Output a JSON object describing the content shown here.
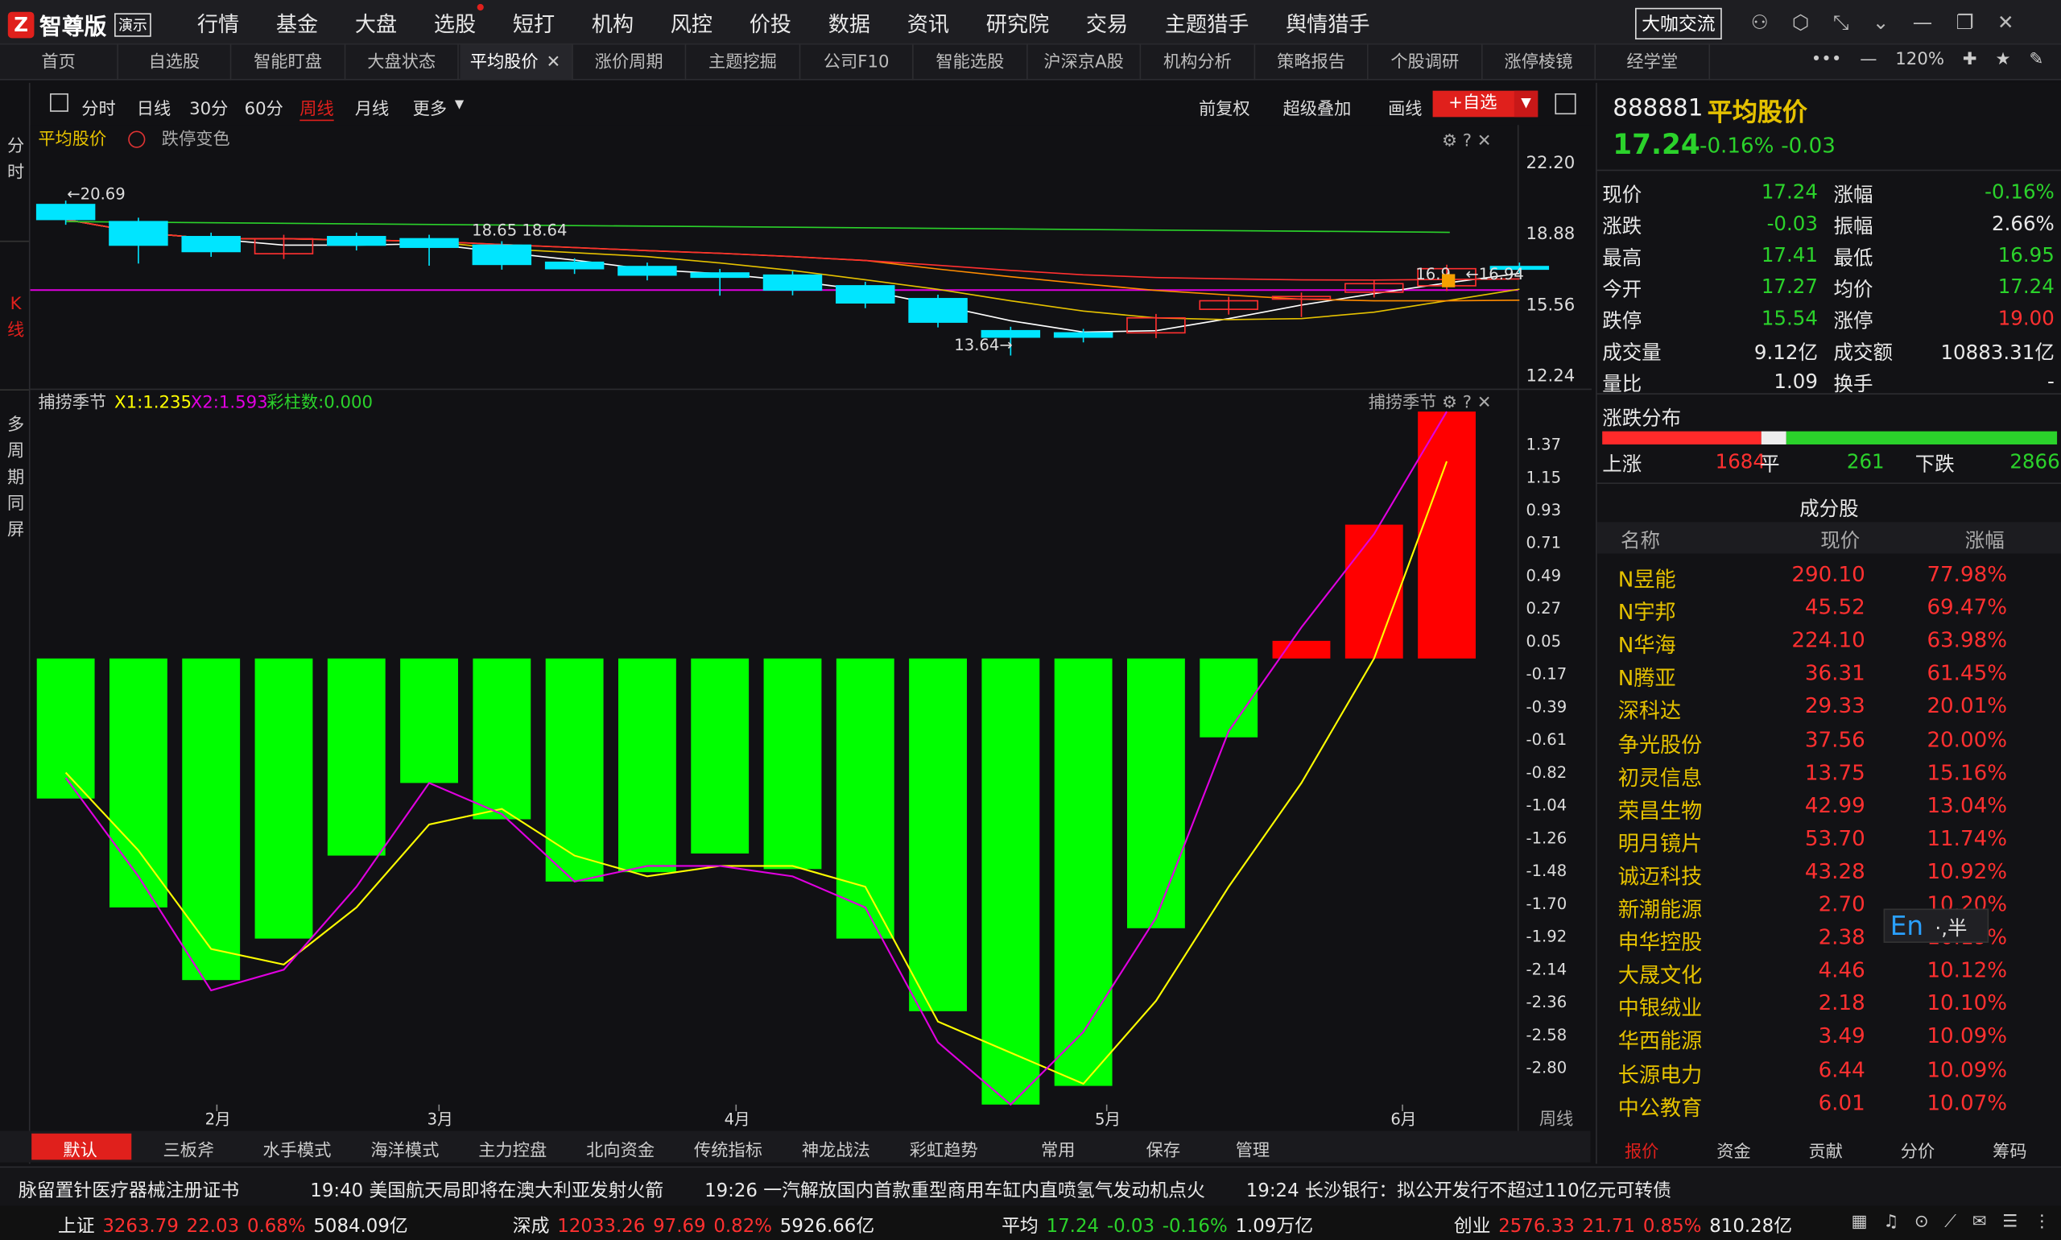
{
  "app": {
    "title": "智尊版",
    "badge": "演示"
  },
  "menu": [
    "行情",
    "基金",
    "大盘",
    "选股",
    "短打",
    "机构",
    "风控",
    "价投",
    "数据",
    "资讯",
    "研究院",
    "交易",
    "主题猎手",
    "舆情猎手"
  ],
  "community_button": "大咖交流",
  "tabs": [
    "首页",
    "自选股",
    "智能盯盘",
    "大盘状态",
    "平均股价",
    "涨价周期",
    "主题挖掘",
    "公司F10",
    "智能选股",
    "沪深京A股",
    "机构分析",
    "策略报告",
    "个股调研",
    "涨停棱镜",
    "经学堂"
  ],
  "tab_zoom": "120%",
  "side_labels": {
    "intraday": "分时",
    "kline": "K线",
    "multi": "多周期同屏"
  },
  "period_toolbar": {
    "items": [
      "分时",
      "日线",
      "30分",
      "60分",
      "周线",
      "月线",
      "更多"
    ],
    "active": "周线",
    "right": [
      "前复权",
      "超级叠加",
      "画线"
    ],
    "add_fav": "+自选"
  },
  "kline_panel": {
    "name": "平均股价",
    "option": "跌停变色",
    "price_labels": [
      "22.20",
      "18.88",
      "15.56",
      "12.24"
    ],
    "annotations": {
      "high": "20.69",
      "mid": "18.65",
      "mid2": "18.64",
      "low": "13.64",
      "last": "16.94",
      "last_left": "16.9"
    }
  },
  "indicator_panel": {
    "name": "捕捞季节",
    "x1": "X1:1.235",
    "x2": "X2:1.593",
    "count": "彩柱数:0.000",
    "axis": [
      "1.37",
      "1.15",
      "0.93",
      "0.71",
      "0.49",
      "0.27",
      "0.05",
      "-0.17",
      "-0.39",
      "-0.61",
      "-0.82",
      "-1.04",
      "-1.26",
      "-1.48",
      "-1.70",
      "-1.92",
      "-2.14",
      "-2.36",
      "-2.58",
      "-2.80"
    ]
  },
  "x_months": [
    "2月",
    "3月",
    "4月",
    "5月",
    "6月"
  ],
  "period_label": "周线",
  "chart_data": {
    "type": "bar",
    "kline": {
      "candles": [
        {
          "o": 20.2,
          "c": 19.5
        },
        {
          "o": 19.4,
          "c": 18.3
        },
        {
          "o": 18.7,
          "c": 18.0
        },
        {
          "o": 17.9,
          "c": 18.6
        },
        {
          "o": 18.7,
          "c": 18.3
        },
        {
          "o": 18.6,
          "c": 18.2
        },
        {
          "o": 18.3,
          "c": 17.4
        },
        {
          "o": 17.5,
          "c": 17.2
        },
        {
          "o": 17.3,
          "c": 16.9
        },
        {
          "o": 17.0,
          "c": 16.8
        },
        {
          "o": 16.9,
          "c": 16.2
        },
        {
          "o": 16.4,
          "c": 15.6
        },
        {
          "o": 15.8,
          "c": 14.7
        },
        {
          "o": 14.3,
          "c": 14.0
        },
        {
          "o": 14.2,
          "c": 14.0
        },
        {
          "o": 14.2,
          "c": 14.9
        },
        {
          "o": 15.3,
          "c": 15.7
        },
        {
          "o": 15.8,
          "c": 15.9
        },
        {
          "o": 16.1,
          "c": 16.5
        },
        {
          "o": 16.4,
          "c": 17.2
        },
        {
          "o": 17.3,
          "c": 17.24
        }
      ],
      "ylim": [
        12.24,
        22.2
      ]
    },
    "histogram": {
      "values": [
        -1.35,
        -2.4,
        -3.1,
        -2.7,
        -1.9,
        -1.2,
        -1.55,
        -2.15,
        -2.06,
        -1.88,
        -2.03,
        -2.7,
        -3.4,
        -4.3,
        -4.12,
        -2.6,
        -0.76,
        0.17,
        1.29,
        2.38
      ],
      "ylim": [
        -4.3,
        2.38
      ]
    },
    "series": [
      {
        "name": "X1",
        "color": "#ffff00",
        "values": [
          -1.1,
          -1.85,
          -2.8,
          -2.95,
          -2.4,
          -1.6,
          -1.45,
          -1.9,
          -2.1,
          -2.0,
          -2.0,
          -2.2,
          -3.5,
          -3.8,
          -4.1,
          -3.3,
          -2.2,
          -1.2,
          0.0,
          1.9
        ]
      },
      {
        "name": "X2",
        "color": "#e000e0",
        "values": [
          -1.15,
          -2.1,
          -3.2,
          -3.0,
          -2.2,
          -1.2,
          -1.5,
          -2.15,
          -2.0,
          -2.0,
          -2.1,
          -2.4,
          -3.7,
          -4.3,
          -3.6,
          -2.5,
          -0.7,
          0.3,
          1.2,
          2.38
        ]
      }
    ]
  },
  "quote": {
    "code": "888881",
    "name": "平均股价",
    "price": "17.24",
    "chg_pct": "-0.16%",
    "chg": "-0.03",
    "rows": [
      [
        "现价",
        "17.24",
        "涨幅",
        "-0.16%"
      ],
      [
        "涨跌",
        "-0.03",
        "振幅",
        "2.66%"
      ],
      [
        "最高",
        "17.41",
        "最低",
        "16.95"
      ],
      [
        "今开",
        "17.27",
        "均价",
        "17.24"
      ],
      [
        "跌停",
        "15.54",
        "涨停",
        "19.00"
      ],
      [
        "成交量",
        "9.12亿",
        "成交额",
        "10883.31亿"
      ],
      [
        "量比",
        "1.09",
        "换手",
        "-"
      ]
    ],
    "dist_title": "涨跌分布",
    "up_label": "上涨",
    "up": "1684",
    "flat_label": "平",
    "flat": "261",
    "down_label": "下跌",
    "down": "2866"
  },
  "components": {
    "title": "成分股",
    "headers": [
      "名称",
      "现价",
      "涨幅"
    ],
    "rows": [
      [
        "N昱能",
        "290.10",
        "77.98%"
      ],
      [
        "N宇邦",
        "45.52",
        "69.47%"
      ],
      [
        "N华海",
        "224.10",
        "63.98%"
      ],
      [
        "N腾亚",
        "36.31",
        "61.45%"
      ],
      [
        "深科达",
        "29.33",
        "20.01%"
      ],
      [
        "争光股份",
        "37.56",
        "20.00%"
      ],
      [
        "初灵信息",
        "13.75",
        "15.16%"
      ],
      [
        "荣昌生物",
        "42.99",
        "13.04%"
      ],
      [
        "明月镜片",
        "53.70",
        "11.74%"
      ],
      [
        "诚迈科技",
        "43.28",
        "10.92%"
      ],
      [
        "新潮能源",
        "2.70",
        "10.20%"
      ],
      [
        "申华控股",
        "2.38",
        "10.19%"
      ],
      [
        "大晟文化",
        "4.46",
        "10.12%"
      ],
      [
        "中银绒业",
        "2.18",
        "10.10%"
      ],
      [
        "华西能源",
        "3.49",
        "10.09%"
      ],
      [
        "长源电力",
        "6.44",
        "10.09%"
      ],
      [
        "中公教育",
        "6.01",
        "10.07%"
      ]
    ]
  },
  "ime": "En",
  "ime_extra": "·,半",
  "bottom_tabs": [
    "默认",
    "三板斧",
    "水手模式",
    "海洋模式",
    "主力控盘",
    "北向资金",
    "传统指标",
    "神龙战法",
    "彩虹趋势",
    "常用",
    "保存",
    "管理"
  ],
  "right_tabs": [
    "报价",
    "资金",
    "贡献",
    "分价",
    "筹码"
  ],
  "ticker": [
    "脉留置针医疗器械注册证书",
    "19:40 美国航天局即将在澳大利亚发射火箭",
    "19:26 一汽解放国内首款重型商用车缸内直喷氢气发动机点火",
    "19:24 长沙银行：拟公开发行不超过110亿元可转债"
  ],
  "status": [
    {
      "name": "上证",
      "price": "3263.79",
      "chg": "22.03",
      "pct": "0.68%",
      "amt": "5084.09亿",
      "color": "#ff3030"
    },
    {
      "name": "深成",
      "price": "12033.26",
      "chg": "97.69",
      "pct": "0.82%",
      "amt": "5926.66亿",
      "color": "#ff3030"
    },
    {
      "name": "平均",
      "price": "17.24",
      "chg": "-0.03",
      "pct": "-0.16%",
      "amt": "1.09万亿",
      "color": "#2bd22b"
    },
    {
      "name": "创业",
      "price": "2576.33",
      "chg": "21.71",
      "pct": "0.85%",
      "amt": "810.28亿",
      "color": "#ff3030"
    }
  ]
}
